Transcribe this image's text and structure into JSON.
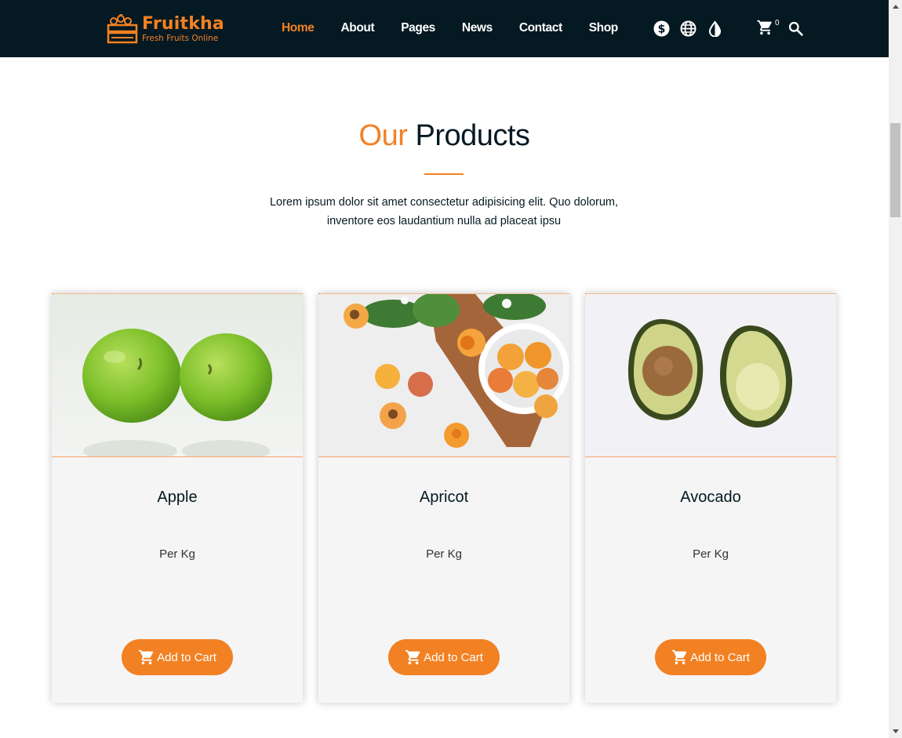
{
  "header": {
    "logo_name": "Fruitkha",
    "logo_tagline": "Fresh Fruits Online",
    "nav": [
      {
        "label": "Home",
        "active": true
      },
      {
        "label": "About",
        "active": false
      },
      {
        "label": "Pages",
        "active": false
      },
      {
        "label": "News",
        "active": false
      },
      {
        "label": "Contact",
        "active": false
      },
      {
        "label": "Shop",
        "active": false
      }
    ],
    "icons": [
      "currency-icon",
      "globe-icon",
      "contrast-icon"
    ],
    "cart_count": "0"
  },
  "section": {
    "title_highlight": "Our",
    "title_rest": "Products",
    "intro_line1": "Lorem ipsum dolor sit amet consectetur adipisicing elit. Quo dolorum,",
    "intro_line2": "inventore eos laudantium nulla ad placeat ipsu"
  },
  "products": [
    {
      "name": "Apple",
      "unit": "Per Kg",
      "button": "Add to Cart"
    },
    {
      "name": "Apricot",
      "unit": "Per Kg",
      "button": "Add to Cart"
    },
    {
      "name": "Avocado",
      "unit": "Per Kg",
      "button": "Add to Cart"
    }
  ],
  "colors": {
    "accent": "#f28123",
    "header_bg": "#051922",
    "card_bg": "#f5f5f5"
  }
}
